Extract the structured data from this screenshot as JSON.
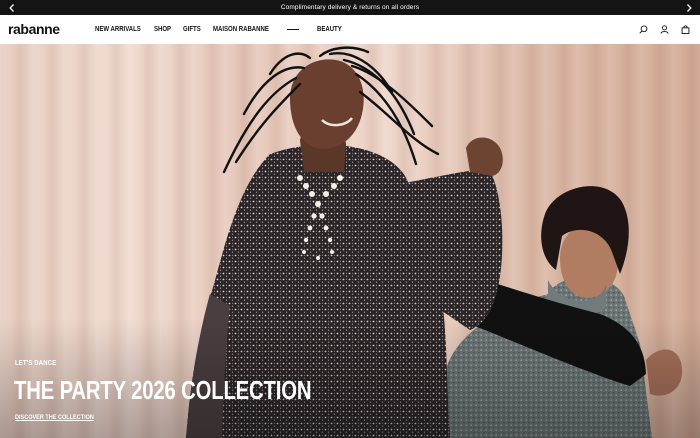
{
  "promo": {
    "message": "Complimentary delivery & returns on all orders",
    "prev_icon": "chevron-left-icon",
    "next_icon": "chevron-right-icon"
  },
  "header": {
    "logo": "rabanne",
    "nav": [
      "NEW ARRIVALS",
      "SHOP",
      "GIFTS",
      "MAISON RABANNE"
    ],
    "nav_after_divider": "BEAUTY",
    "icons": [
      "search-icon",
      "account-icon",
      "bag-icon"
    ]
  },
  "hero": {
    "eyebrow": "LET'S DANCE",
    "headline": "THE PARTY 2026 COLLECTION",
    "cta": "DISCOVER THE COLLECTION"
  },
  "colors": {
    "promo_bg": "#141414",
    "text_dark": "#111111",
    "hero_text": "#ffffff",
    "backdrop": "#e9cfc3"
  }
}
